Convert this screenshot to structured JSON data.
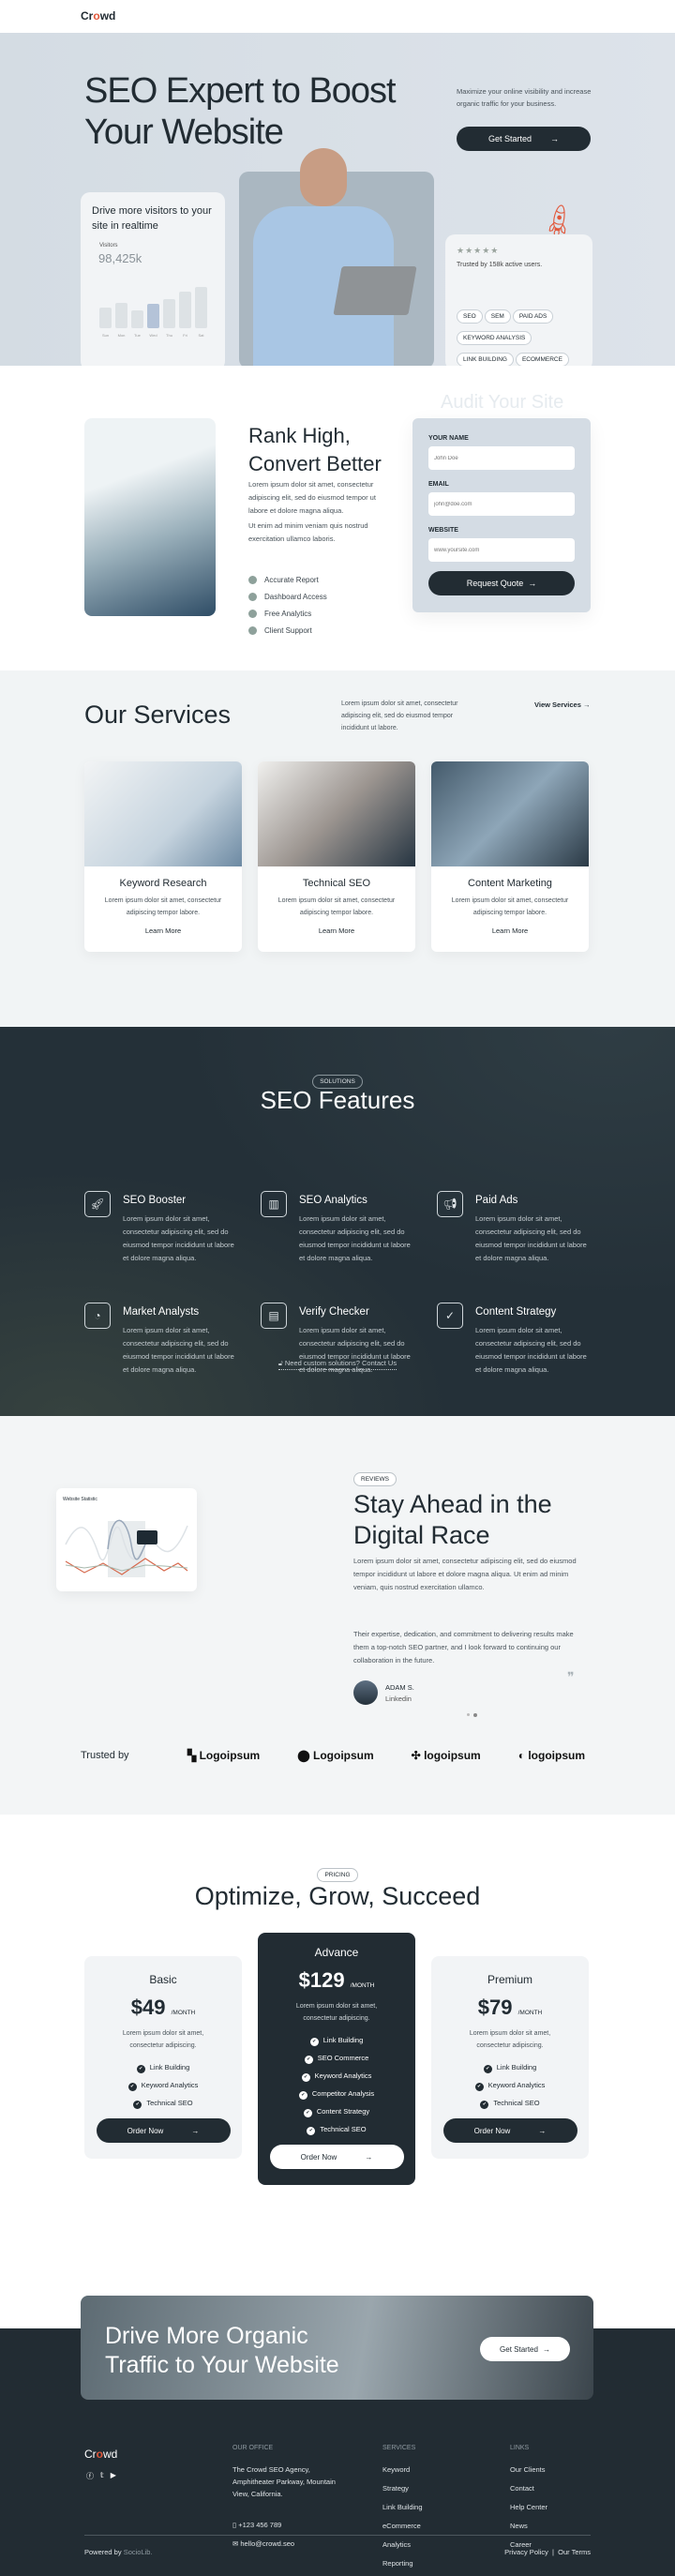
{
  "nav": {
    "logo": "Crowd"
  },
  "hero": {
    "title_line1": "SEO Expert to Boost",
    "title_line2": "Your Website",
    "subtitle": "Maximize your online visibility and increase organic traffic for your business.",
    "cta": "Get Started",
    "visitors_card": {
      "title": "Drive more visitors to your site in realtime",
      "label": "Visitors",
      "value": "98,425k",
      "days": [
        "Sun",
        "Mon",
        "Tue",
        "Wed",
        "Thu",
        "Fri",
        "Sat"
      ],
      "bars": [
        45,
        55,
        38,
        52,
        62,
        78,
        88
      ],
      "highlight": "Wed"
    },
    "trust_card": {
      "stars": 5,
      "text": "Trusted by 158k active users.",
      "tags": [
        "SEO",
        "SEM",
        "PAID ADS",
        "KEYWORD ANALYSIS",
        "LINK BUILDING",
        "ECOMMERCE"
      ]
    }
  },
  "rank": {
    "title_line1": "Rank High,",
    "title_line2": "Convert Better",
    "p1": "Lorem ipsum dolor sit amet, consectetur adipiscing elit, sed do eiusmod tempor ut labore et dolore magna aliqua.",
    "p2": "Ut enim ad minim veniam quis nostrud exercitation ullamco laboris.",
    "checks": [
      "Accurate Report",
      "Dashboard Access",
      "Free Analytics",
      "Client Support"
    ]
  },
  "audit": {
    "title": "Audit Your Site",
    "name_label": "YOUR NAME",
    "name_ph": "John Doe",
    "email_label": "EMAIL",
    "email_ph": "john@doe.com",
    "site_label": "WEBSITE",
    "site_ph": "www.yoursite.com",
    "submit": "Request Quote"
  },
  "services": {
    "title": "Our Services",
    "desc": "Lorem ipsum dolor sit amet, consectetur adipiscing elit, sed do eiusmod tempor incididunt ut labore.",
    "view": "View Services",
    "items": [
      {
        "title": "Keyword Research",
        "desc": "Lorem ipsum dolor sit amet, consectetur adipiscing tempor labore.",
        "link": "Learn More"
      },
      {
        "title": "Technical SEO",
        "desc": "Lorem ipsum dolor sit amet, consectetur adipiscing tempor labore.",
        "link": "Learn More"
      },
      {
        "title": "Content Marketing",
        "desc": "Lorem ipsum dolor sit amet, consectetur adipiscing tempor labore.",
        "link": "Learn More"
      }
    ]
  },
  "features": {
    "badge": "SOLUTIONS",
    "title": "SEO Features",
    "contact": "Need custom solutions? Contact Us",
    "items": [
      {
        "title": "SEO Booster",
        "icon": "rocket-icon",
        "glyph": "🚀︎"
      },
      {
        "title": "SEO Analytics",
        "icon": "bar-chart-icon",
        "glyph": "▥"
      },
      {
        "title": "Paid Ads",
        "icon": "megaphone-icon",
        "glyph": "📢︎"
      },
      {
        "title": "Market Analysts",
        "icon": "pie-chart-icon",
        "glyph": "◔"
      },
      {
        "title": "Verify Checker",
        "icon": "checklist-icon",
        "glyph": "▤"
      },
      {
        "title": "Content Strategy",
        "icon": "spellcheck-icon",
        "glyph": "✓"
      }
    ],
    "desc": "Lorem ipsum dolor sit amet, consectetur adipiscing elit, sed do eiusmod tempor incididunt ut labore et dolore magna aliqua."
  },
  "reviews": {
    "chart_title": "Website Statistic",
    "badge": "REVIEWS",
    "title_line1": "Stay Ahead in the",
    "title_line2": "Digital Race",
    "desc": "Lorem ipsum dolor sit amet, consectetur adipiscing elit, sed do eiusmod tempor incididunt ut labore et dolore magna aliqua. Ut enim ad minim veniam, quis nostrud exercitation ullamco.",
    "quote": "Their expertise, dedication, and commitment to delivering results make them a top-notch SEO partner, and I look forward to continuing our collaboration in the future.",
    "author": "ADAM S.",
    "source": "Linkedin"
  },
  "trusted": {
    "label": "Trusted by",
    "logos": [
      "Logoipsum",
      "Logoipsum",
      "logoipsum",
      "logoipsum"
    ]
  },
  "pricing": {
    "badge": "PRICING",
    "title": "Optimize, Grow, Succeed",
    "per": "/MONTH",
    "desc": "Lorem ipsum dolor sit amet, consectetur adipiscing.",
    "order": "Order Now",
    "plans": [
      {
        "name": "Basic",
        "price": "$49",
        "features": [
          "Link Building",
          "Keyword Analytics",
          "Technical SEO"
        ]
      },
      {
        "name": "Advance",
        "price": "$129",
        "features": [
          "Link Building",
          "SEO Commerce",
          "Keyword Analytics",
          "Competitor Analysis",
          "Content Strategy",
          "Technical SEO"
        ]
      },
      {
        "name": "Premium",
        "price": "$79",
        "features": [
          "Link Building",
          "Keyword Analytics",
          "Technical SEO"
        ]
      }
    ]
  },
  "cta": {
    "title_line1": "Drive More Organic",
    "title_line2": "Traffic to Your Website",
    "button": "Get Started"
  },
  "footer": {
    "logo": "Crowd",
    "office_h": "OUR OFFICE",
    "address": "The Crowd SEO Agency, Amphitheater Parkway, Mountain View, California.",
    "phone": "+123 456 789",
    "email": "hello@crowd.seo",
    "services_h": "SERVICES",
    "services": [
      "Keyword",
      "Strategy",
      "Link Building",
      "eCommerce",
      "Analytics",
      "Reporting"
    ],
    "links_h": "LINKS",
    "links": [
      "Our Clients",
      "Contact",
      "Help Center",
      "News",
      "Career"
    ],
    "powered": "Powered by",
    "brand": "SocioLib.",
    "privacy": "Privacy Policy",
    "terms": "Our Terms"
  },
  "colors": {
    "dark": "#222c33",
    "accent": "#e2573a",
    "hero_bg": "#d5dde4"
  }
}
